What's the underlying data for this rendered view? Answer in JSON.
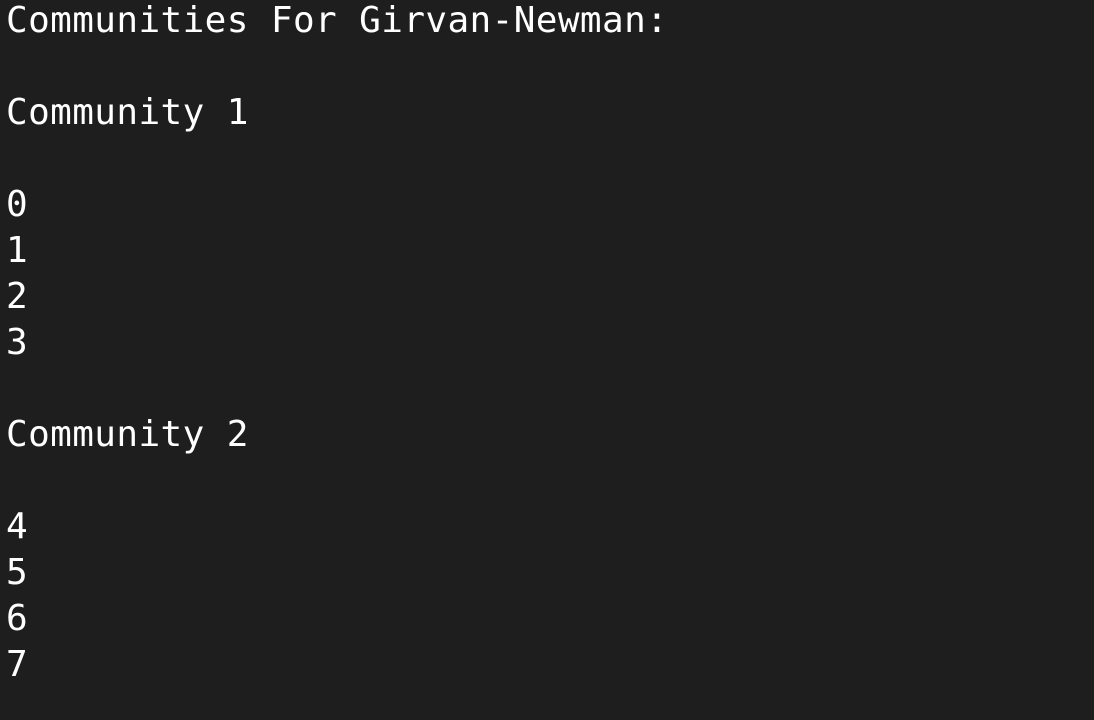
{
  "colors": {
    "background": "#1e1e1e",
    "text": "#ffffff"
  },
  "output": {
    "header": "Communities For Girvan-Newman:",
    "communities": [
      {
        "title": "Community 1",
        "members": [
          "0",
          "1",
          "2",
          "3"
        ]
      },
      {
        "title": "Community 2",
        "members": [
          "4",
          "5",
          "6",
          "7"
        ]
      }
    ]
  }
}
